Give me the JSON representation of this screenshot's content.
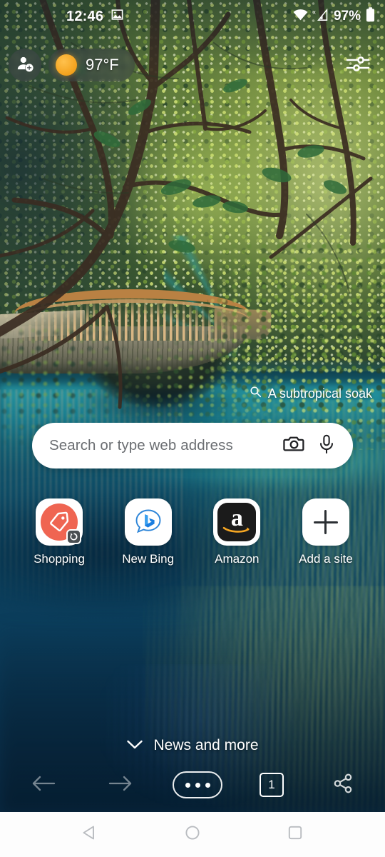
{
  "status_bar": {
    "time": "12:46",
    "notification_icon": "image-icon",
    "wifi_icon": "wifi-icon",
    "cellular_icon": "cellular-no-sim-icon",
    "battery_percent": "97%",
    "battery_icon": "battery-icon"
  },
  "top_bar": {
    "profile_icon": "add-profile-icon",
    "weather": {
      "icon": "sun-icon",
      "temperature": "97°F"
    },
    "settings_icon": "sliders-settings-icon"
  },
  "wallpaper": {
    "credit_icon": "search-icon",
    "credit_text": "A subtropical soak"
  },
  "search": {
    "placeholder": "Search or type web address",
    "camera_icon": "camera-icon",
    "mic_icon": "microphone-icon"
  },
  "shortcuts": [
    {
      "label": "Shopping",
      "icon": "price-tag-icon",
      "badge": "refresh-badge-icon",
      "color": "#ef6552"
    },
    {
      "label": "New Bing",
      "icon": "bing-chat-icon",
      "color": "#1b7ee0"
    },
    {
      "label": "Amazon",
      "icon": "amazon-a-icon",
      "letter": "a",
      "color": "#1b1b1b"
    },
    {
      "label": "Add a site",
      "icon": "plus-icon"
    }
  ],
  "news": {
    "chevron_icon": "chevron-down-icon",
    "label": "News and more"
  },
  "toolbar": {
    "back_icon": "arrow-left-icon",
    "forward_icon": "arrow-right-icon",
    "menu_icon": "more-options-icon",
    "tab_count": "1",
    "share_icon": "share-icon"
  },
  "android_nav": {
    "back_icon": "nav-back-triangle-icon",
    "home_icon": "nav-home-circle-icon",
    "recents_icon": "nav-recents-square-icon"
  },
  "colors": {
    "accent_orange": "#f5a623",
    "shopping_red": "#ef6552",
    "amazon_black": "#1b1b1b",
    "water_teal": "#14707f",
    "chip_bg": "rgba(60,68,70,.58)"
  }
}
